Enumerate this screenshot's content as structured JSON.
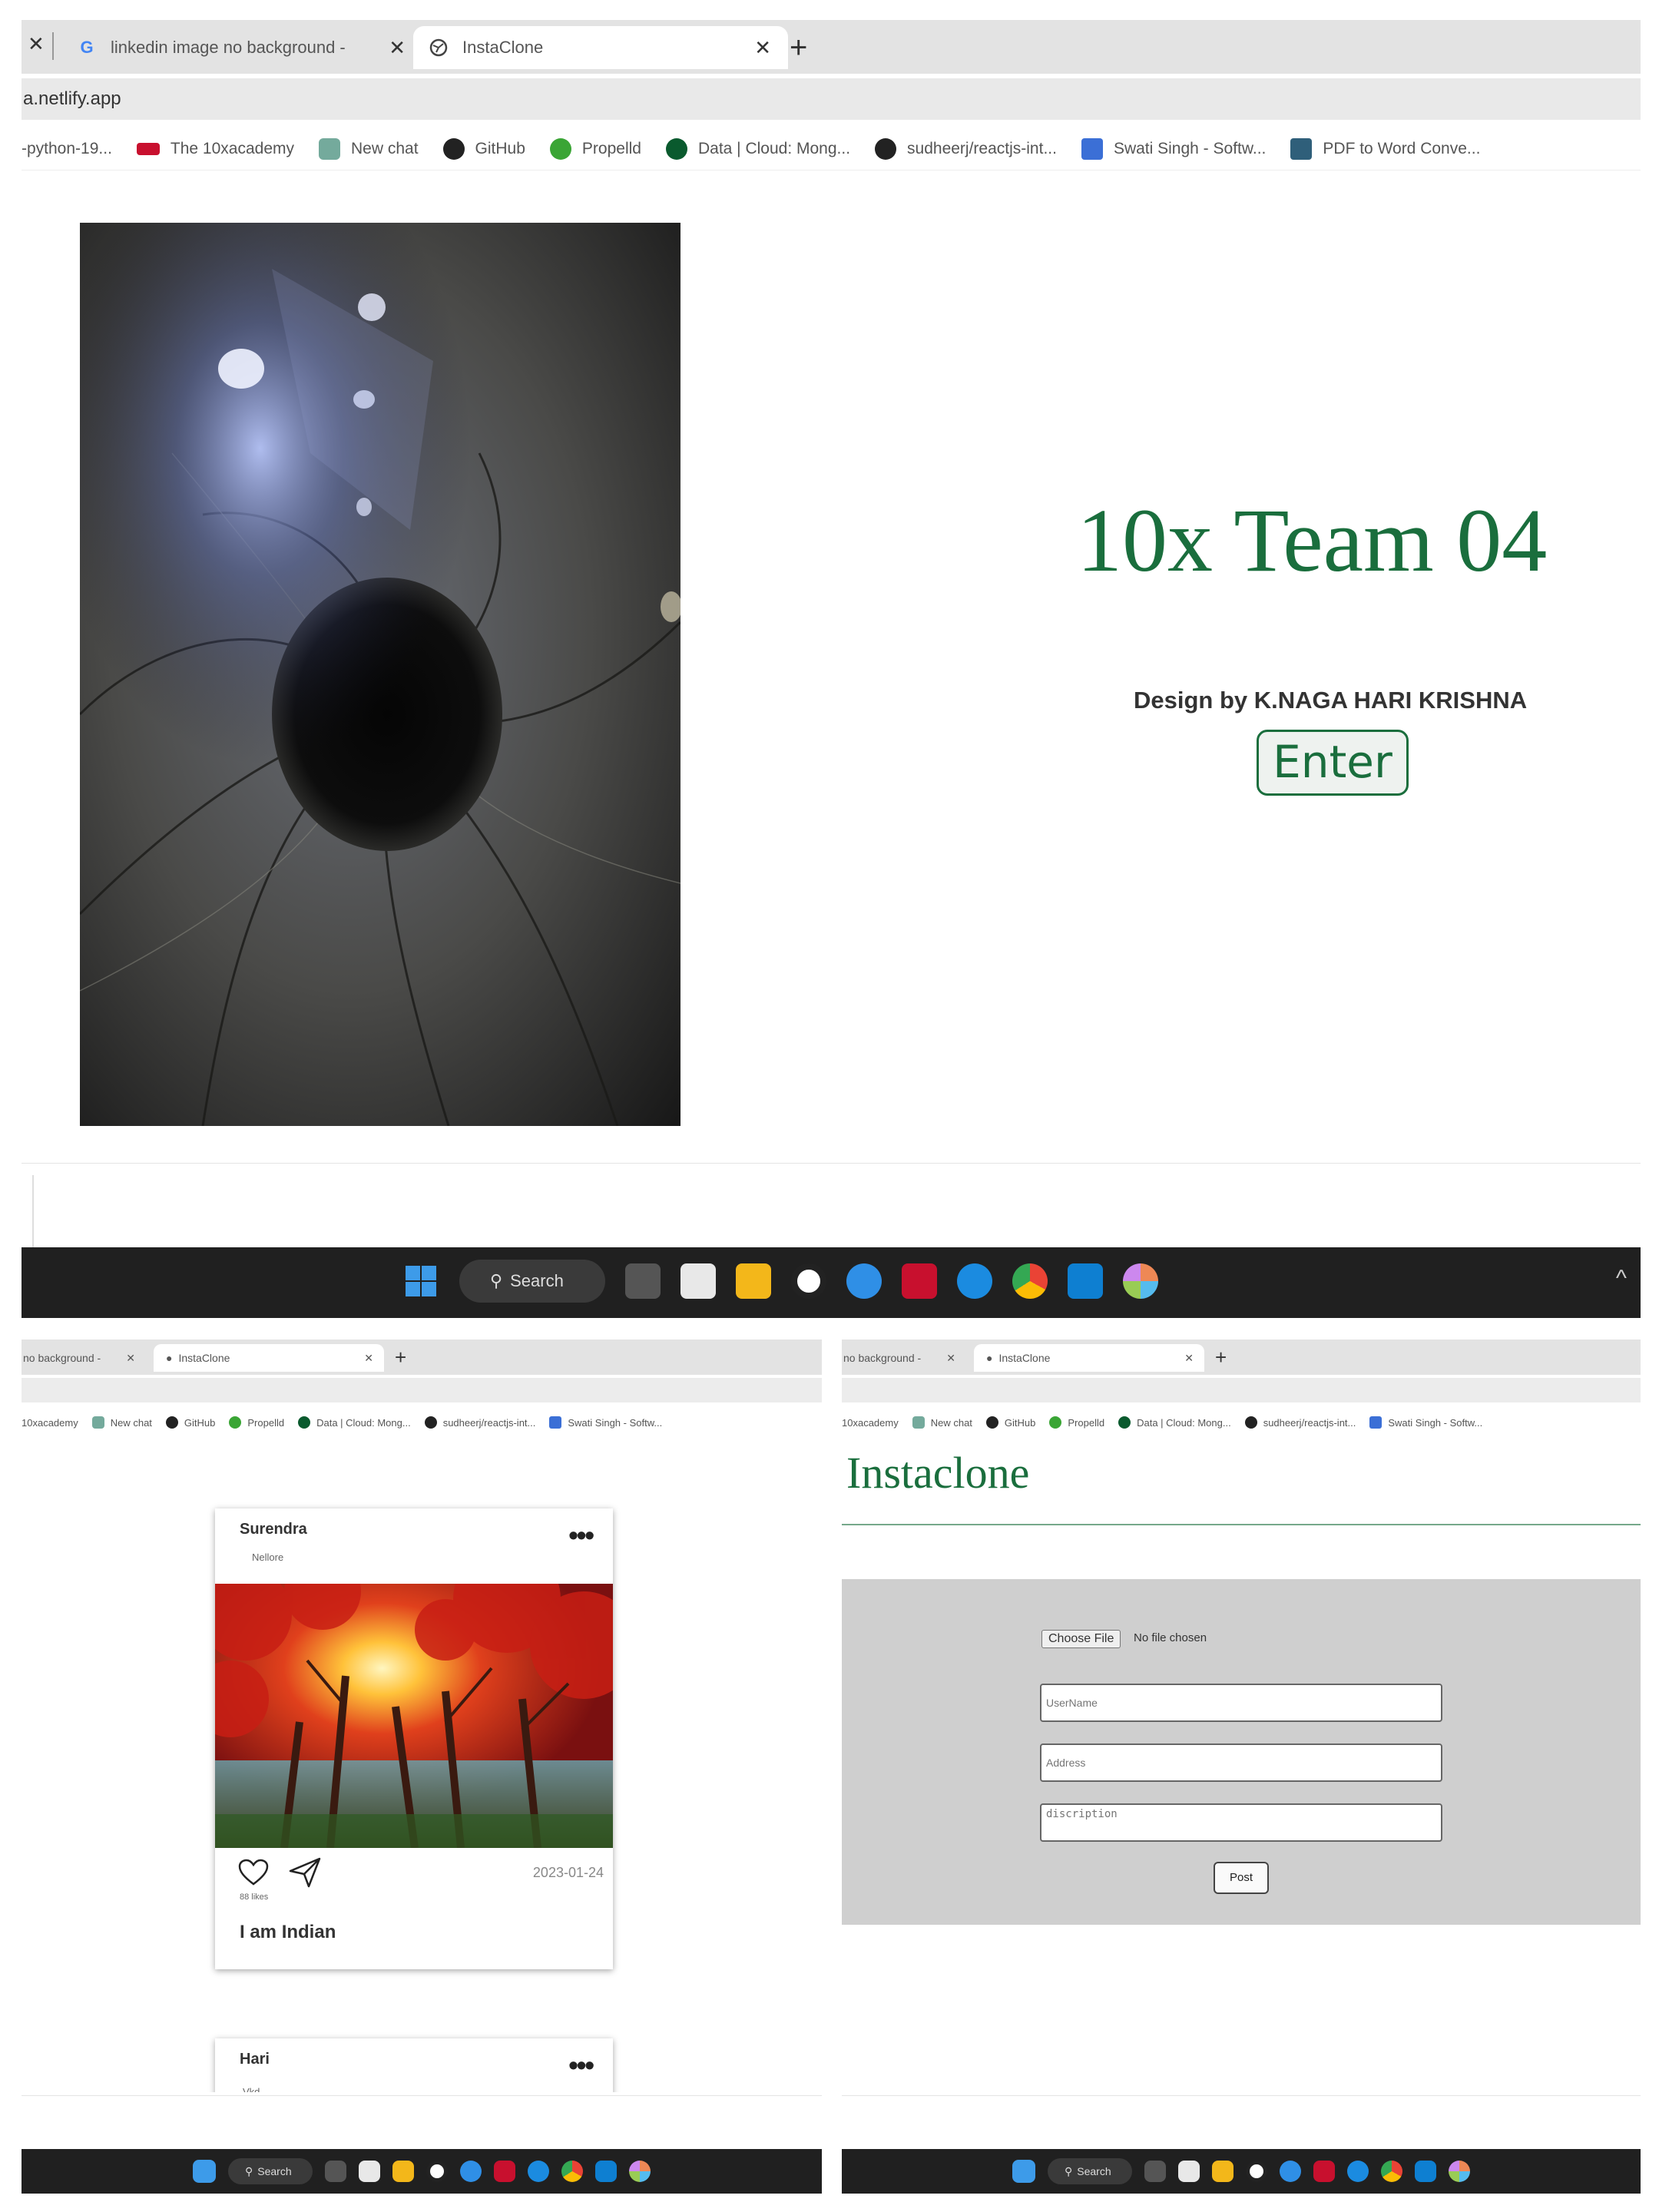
{
  "top": {
    "tabs": [
      {
        "label": "linkedin image no background -",
        "close": "✕"
      },
      {
        "label": "InstaClone",
        "close": "✕"
      }
    ],
    "first_tab_close": "✕",
    "new_tab": "+",
    "address": "a.netlify.app",
    "bookmarks": [
      {
        "label": "-python-19...",
        "icon": "none"
      },
      {
        "label": "The 10xacademy",
        "icon": "10x-logo-icon",
        "color": "#c8102e"
      },
      {
        "label": "New chat",
        "icon": "chatgpt-icon",
        "color": "#74aa9c"
      },
      {
        "label": "GitHub",
        "icon": "github-icon",
        "color": "#222222"
      },
      {
        "label": "Propelld",
        "icon": "propelld-icon",
        "color": "#3aa535"
      },
      {
        "label": "Data | Cloud: Mong...",
        "icon": "mongodb-icon",
        "color": "#0a5a2e"
      },
      {
        "label": "sudheerj/reactjs-int...",
        "icon": "github-icon",
        "color": "#222222"
      },
      {
        "label": "Swati Singh - Softw...",
        "icon": "linkedin-icon",
        "color": "#3b6fd6"
      },
      {
        "label": "PDF to Word Conve...",
        "icon": "pdf-icon",
        "color": "#2f5f7a"
      }
    ],
    "landing": {
      "title": "10x Team 04",
      "subtitle": "Design by K.NAGA HARI KRISHNA",
      "enter_label": "Enter"
    }
  },
  "taskbar": {
    "search_label": "Search",
    "apps": [
      "windows-start-icon",
      "task-view-icon",
      "store-icon",
      "file-explorer-icon",
      "chatgpt-icon",
      "edge-dev-icon",
      "mcafee-icon",
      "edge-icon",
      "chrome-icon",
      "vscode-icon",
      "color-picker-icon"
    ],
    "tray_chevron": "^"
  },
  "bottom_left": {
    "tabs": [
      {
        "label": "no background -",
        "close": "✕"
      },
      {
        "label": "InstaClone",
        "close": "✕"
      }
    ],
    "new_tab": "+",
    "bookmarks": [
      "10xacademy",
      "New chat",
      "GitHub",
      "Propelld",
      "Data | Cloud: Mong...",
      "sudheerj/reactjs-int...",
      "Swati Singh - Softw..."
    ],
    "posts": [
      {
        "user": "Surendra",
        "location": "Nellore",
        "more": "•••",
        "date": "2023-01-24",
        "likes": "88 likes",
        "description": "I am Indian"
      },
      {
        "user": "Hari",
        "location": "Vkd",
        "more": "•••"
      }
    ]
  },
  "bottom_right": {
    "tabs": [
      {
        "label": "no background -",
        "close": "✕"
      },
      {
        "label": "InstaClone",
        "close": "✕"
      }
    ],
    "new_tab": "+",
    "bookmarks": [
      "10xacademy",
      "New chat",
      "GitHub",
      "Propelld",
      "Data | Cloud: Mong...",
      "sudheerj/reactjs-int...",
      "Swati Singh - Softw..."
    ],
    "brand": "Instaclone",
    "form": {
      "file_button": "Choose File",
      "file_status": "No file chosen",
      "username_placeholder": "UserName",
      "address_placeholder": "Address",
      "description_placeholder": "discription",
      "post_label": "Post"
    }
  },
  "colors": {
    "accent_green": "#1a6e3d",
    "taskbar_bg": "#202020",
    "form_bg": "#cfcfcf"
  }
}
